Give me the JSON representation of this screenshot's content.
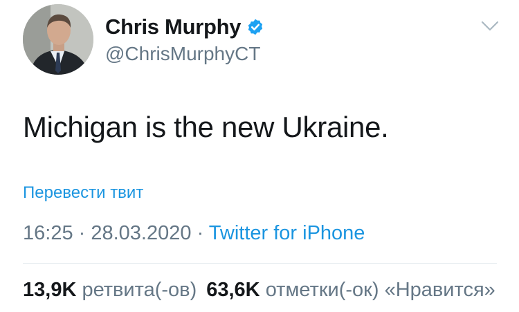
{
  "author": {
    "display_name": "Chris Murphy",
    "handle": "@ChrisMurphyCT",
    "verified": true,
    "avatar": "profile-photo"
  },
  "tweet": {
    "text": "Michigan is the new Ukraine.",
    "translate_label": "Перевести твит",
    "time": "16:25",
    "separator": " · ",
    "date": "28.03.2020",
    "source": "Twitter for iPhone"
  },
  "stats": {
    "retweets_count": "13,9K",
    "retweets_label": "ретвита(-ов)",
    "likes_count": "63,6K",
    "likes_label": "отметки(-ок) «Нравится»"
  },
  "colors": {
    "link": "#1b95e0",
    "secondary_text": "#657786",
    "primary_text": "#14171a",
    "verified_badge": "#1da1f2",
    "divider": "#e1e8ed"
  },
  "icons": [
    "verified-badge-icon",
    "chevron-down-icon"
  ]
}
